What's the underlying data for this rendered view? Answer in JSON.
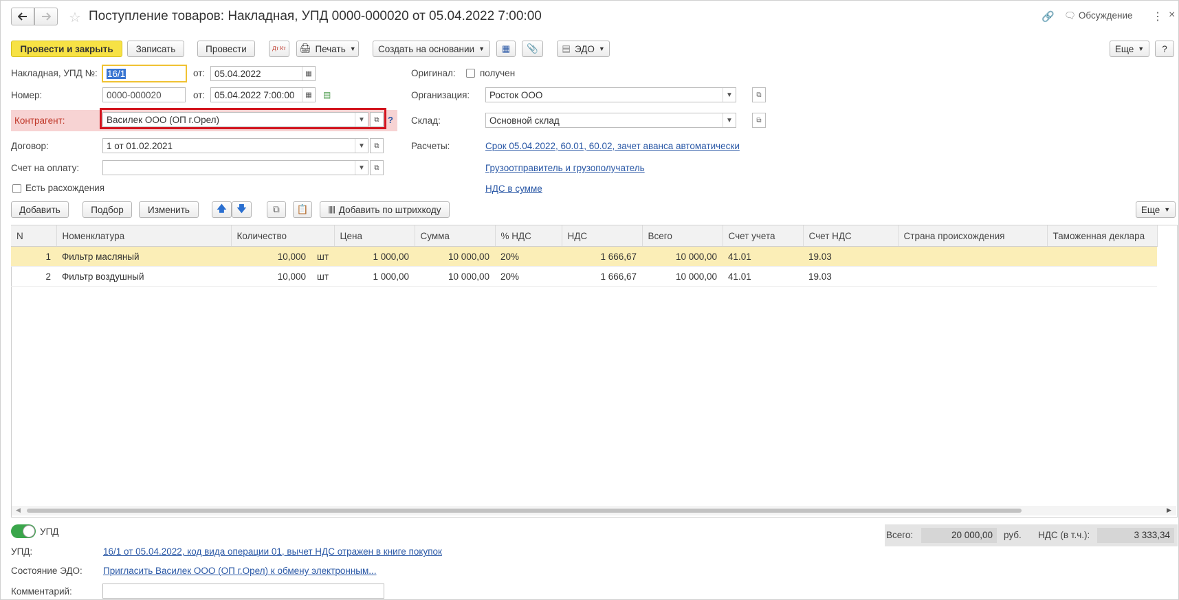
{
  "window": {
    "title": "Поступление товаров: Накладная, УПД 0000-000020 от 05.04.2022 7:00:00",
    "discuss_label": "Обсуждение"
  },
  "toolbar": {
    "post_close": "Провести и закрыть",
    "save": "Записать",
    "post": "Провести",
    "dtkt": "Дт Кт",
    "print": "Печать",
    "create_based": "Создать на основании",
    "edo": "ЭДО",
    "more": "Еще",
    "help": "?"
  },
  "header": {
    "invoice_label": "Накладная, УПД №:",
    "invoice_value": "16/1",
    "from_label": "от:",
    "invoice_date": "05.04.2022",
    "number_label": "Номер:",
    "number_value": "0000-000020",
    "number_date": "05.04.2022  7:00:00",
    "counterparty_label": "Контрагент:",
    "counterparty_value": "Василек ООО (ОП г.Орел)",
    "contract_label": "Договор:",
    "contract_value": "1 от 01.02.2021",
    "invoice_pay_label": "Счет на оплату:",
    "invoice_pay_value": "",
    "discrepancy_label": "Есть расхождения",
    "original_label": "Оригинал:",
    "original_received": "получен",
    "org_label": "Организация:",
    "org_value": "Росток ООО",
    "warehouse_label": "Склад:",
    "warehouse_value": "Основной склад",
    "settlements_label": "Расчеты:",
    "settlements_link": "Срок 05.04.2022, 60.01, 60.02, зачет аванса автоматически",
    "shipper_link": "Грузоотправитель и грузополучатель",
    "vat_link": "НДС в сумме"
  },
  "table_toolbar": {
    "add": "Добавить",
    "select": "Подбор",
    "edit": "Изменить",
    "barcode": "Добавить по штрихкоду",
    "more": "Еще"
  },
  "table": {
    "columns": [
      "N",
      "Номенклатура",
      "Количество",
      "Цена",
      "Сумма",
      "% НДС",
      "НДС",
      "Всего",
      "Счет учета",
      "Счет НДС",
      "Страна происхождения",
      "Таможенная деклара"
    ],
    "rows": [
      {
        "n": "1",
        "item": "Фильтр масляный",
        "qty": "10,000",
        "unit": "шт",
        "price": "1 000,00",
        "sum": "10 000,00",
        "vat_rate": "20%",
        "vat": "1 666,67",
        "total": "10 000,00",
        "account": "41.01",
        "vat_account": "19.03",
        "country": "",
        "customs": ""
      },
      {
        "n": "2",
        "item": "Фильтр воздушный",
        "qty": "10,000",
        "unit": "шт",
        "price": "1 000,00",
        "sum": "10 000,00",
        "vat_rate": "20%",
        "vat": "1 666,67",
        "total": "10 000,00",
        "account": "41.01",
        "vat_account": "19.03",
        "country": "",
        "customs": ""
      }
    ]
  },
  "footer": {
    "upd_toggle": "УПД",
    "upd_label": "УПД:",
    "upd_link": "16/1 от 05.04.2022, код вида операции 01, вычет НДС отражен в книге покупок",
    "edo_state_label": "Состояние ЭДО:",
    "edo_state_link": "Пригласить Василек ООО (ОП г.Орел) к обмену электронным...",
    "comment_label": "Комментарий:",
    "comment_value": "",
    "total_label": "Всего:",
    "total_value": "20 000,00",
    "currency": "руб.",
    "vat_incl_label": "НДС (в т.ч.):",
    "vat_incl_value": "3 333,34"
  }
}
